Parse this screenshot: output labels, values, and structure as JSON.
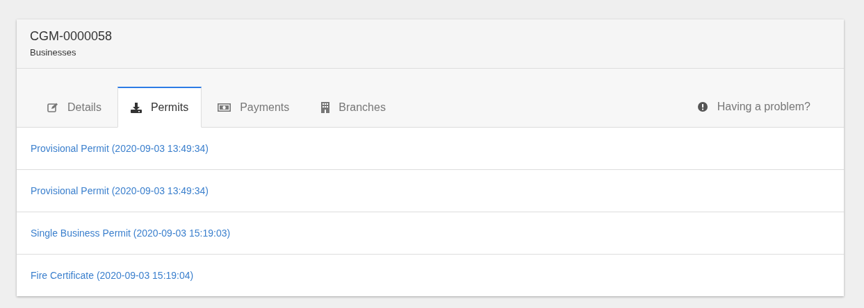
{
  "header": {
    "title": "CGM-0000058",
    "subtitle": "Businesses"
  },
  "tabs": [
    {
      "label": "Details",
      "kind": "edit",
      "selected": false
    },
    {
      "label": "Permits",
      "kind": "download",
      "selected": true
    },
    {
      "label": "Payments",
      "kind": "money",
      "selected": false
    },
    {
      "label": "Branches",
      "kind": "building",
      "selected": false
    }
  ],
  "help_link": {
    "label": "Having a problem?"
  },
  "permits": [
    {
      "label": "Provisional Permit (2020-09-03 13:49:34)"
    },
    {
      "label": "Provisional Permit (2020-09-03 13:49:34)"
    },
    {
      "label": "Single Business Permit (2020-09-03 15:19:03)"
    },
    {
      "label": "Fire Certificate (2020-09-03 15:19:04)"
    }
  ]
}
